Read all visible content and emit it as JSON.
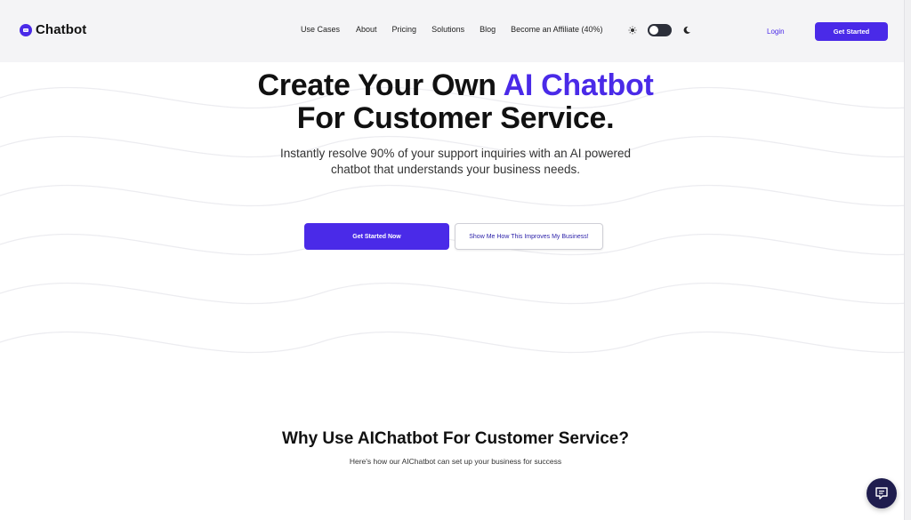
{
  "colors": {
    "accent": "#4a2ae8",
    "navbar_bg": "#f4f4f6",
    "text": "#111111",
    "chat_launcher": "#1f1d4e"
  },
  "brand": {
    "name": "Chatbot",
    "icon": "chatbot-logo-icon"
  },
  "nav": {
    "links": [
      "Use Cases",
      "About",
      "Pricing",
      "Solutions",
      "Blog",
      "Become an Affiliate (40%)"
    ],
    "theme_toggle": {
      "light_icon": "sun-icon",
      "dark_icon": "moon-icon",
      "state": "light"
    },
    "login_label": "Login",
    "get_started_label": "Get Started"
  },
  "hero": {
    "title_line1_plain": "Create Your Own ",
    "title_line1_accent": "AI Chatbot",
    "title_line2": "For Customer Service.",
    "subtitle": "Instantly resolve 90% of your support inquiries with an AI powered chatbot that understands your business needs.",
    "primary_cta": "Get Started Now",
    "secondary_cta": "Show Me How This Improves My Business!"
  },
  "why": {
    "title": "Why Use AIChatbot For Customer Service?",
    "subtitle": "Here's how our AIChatbot can set up your business for success"
  },
  "chat_widget": {
    "icon": "chat-bubble-icon"
  }
}
